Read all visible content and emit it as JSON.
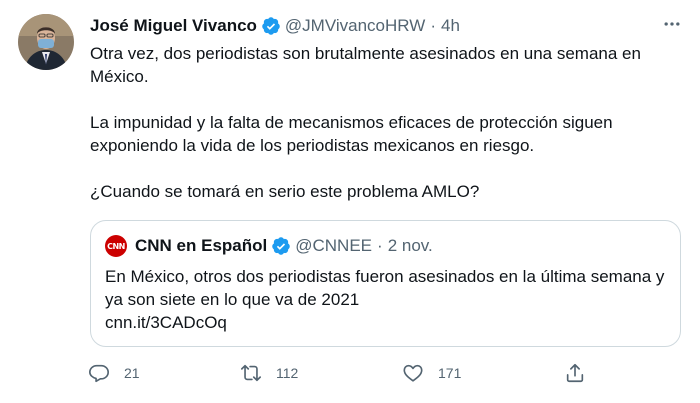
{
  "author": {
    "name": "José Miguel Vivanco",
    "handle": "@JMVivancoHRW",
    "separator": "·",
    "time": "4h"
  },
  "body": {
    "paragraphs": [
      "Otra vez, dos periodistas son brutalmente asesinados en una semana en México.",
      "La impunidad y la falta de mecanismos eficaces de protección siguen exponiendo la vida de los periodistas mexicanos en riesgo.",
      "¿Cuando se tomará en serio este problema AMLO?"
    ]
  },
  "quote": {
    "avatar_text": "CNN",
    "name": "CNN en Español",
    "handle": "@CNNEE",
    "separator": "·",
    "time": "2 nov.",
    "text": "En México, otros dos periodistas fueron asesinados en la última semana y ya son siete en lo que va de 2021",
    "link": "cnn.it/3CADcOq"
  },
  "actions": {
    "replies": "21",
    "retweets": "112",
    "likes": "171"
  },
  "colors": {
    "verified": "#1d9bf0",
    "secondary_text": "#536471",
    "border": "#cfd9de",
    "cnn_red": "#cc0000"
  },
  "icons": [
    "verified-badge-icon",
    "more-options-icon",
    "reply-icon",
    "retweet-icon",
    "like-icon",
    "share-icon"
  ]
}
